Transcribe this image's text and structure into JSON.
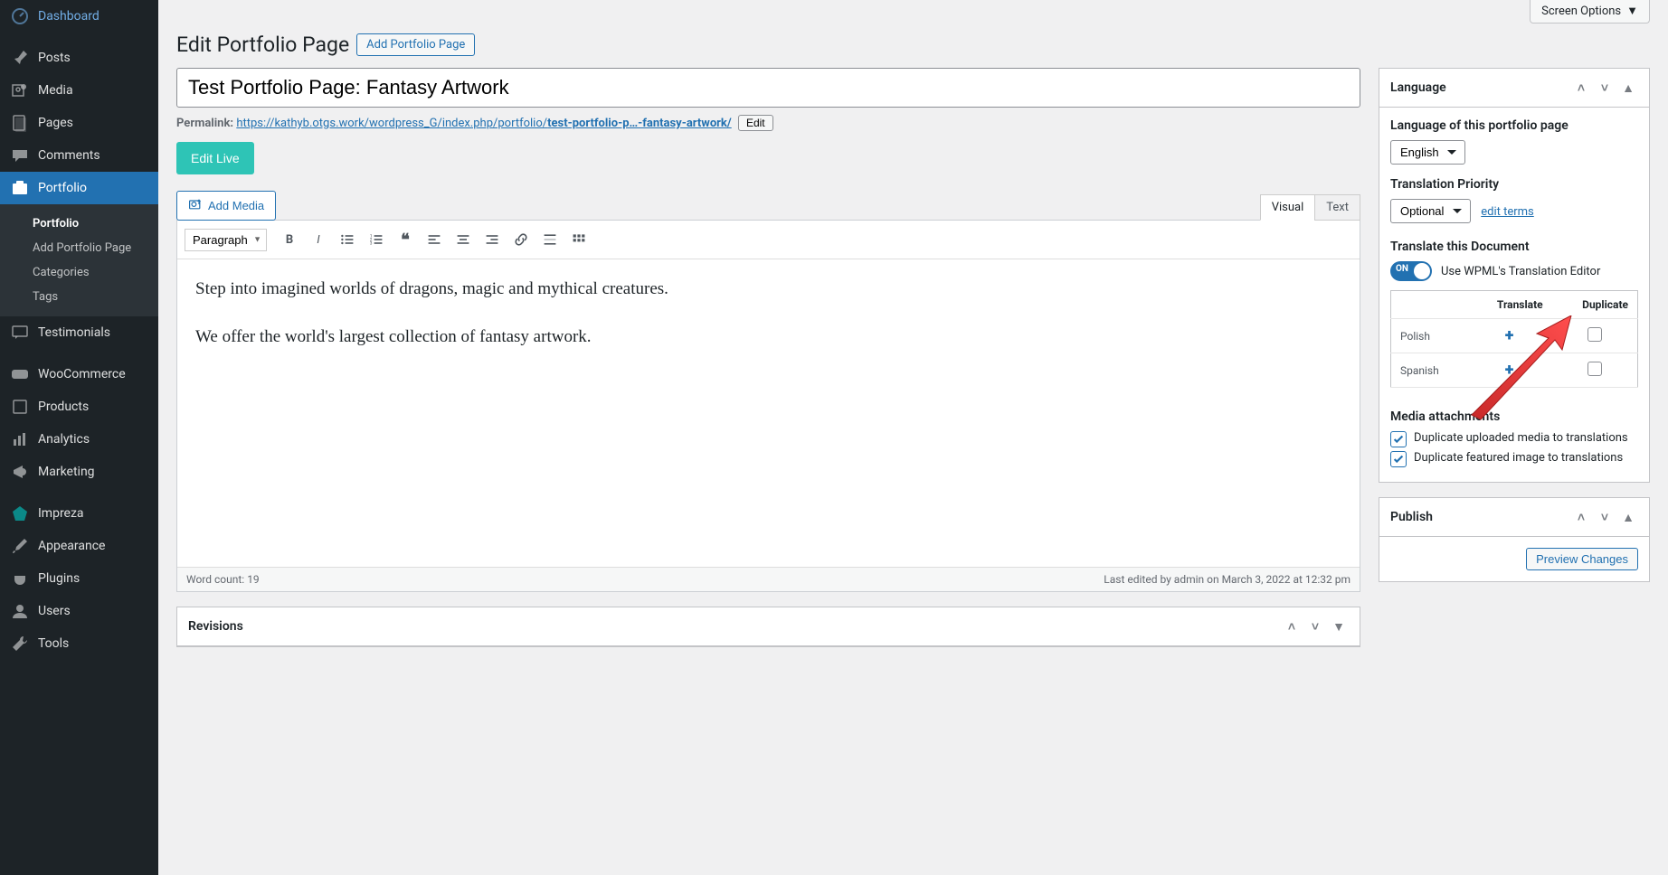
{
  "sidebar": {
    "dashboard": "Dashboard",
    "posts": "Posts",
    "media": "Media",
    "pages": "Pages",
    "comments": "Comments",
    "portfolio": "Portfolio",
    "portfolio_sub": {
      "portfolio": "Portfolio",
      "add": "Add Portfolio Page",
      "categories": "Categories",
      "tags": "Tags"
    },
    "testimonials": "Testimonials",
    "woocommerce": "WooCommerce",
    "products": "Products",
    "analytics": "Analytics",
    "marketing": "Marketing",
    "impreza": "Impreza",
    "appearance": "Appearance",
    "plugins": "Plugins",
    "users": "Users",
    "tools": "Tools"
  },
  "screen_options": "Screen Options",
  "heading": "Edit Portfolio Page",
  "add_new": "Add Portfolio Page",
  "title_value": "Test Portfolio Page: Fantasy Artwork",
  "permalink": {
    "label": "Permalink:",
    "base": "https://kathyb.otgs.work/wordpress_G/index.php/portfolio/",
    "slug": "test-portfolio-p…-fantasy-artwork/",
    "edit": "Edit"
  },
  "edit_live": "Edit Live",
  "add_media": "Add Media",
  "tabs": {
    "visual": "Visual",
    "text": "Text"
  },
  "paragraph_sel": "Paragraph",
  "content": {
    "p1": "Step into imagined worlds of dragons, magic and mythical creatures.",
    "p2": "We offer the world's largest collection of fantasy artwork."
  },
  "status": {
    "word_count_label": "Word count: ",
    "word_count": "19",
    "last_edited": "Last edited by admin on March 3, 2022 at 12:32 pm"
  },
  "revisions_title": "Revisions",
  "language_panel": {
    "title": "Language",
    "lang_label": "Language of this portfolio page",
    "lang_value": "English",
    "priority_label": "Translation Priority",
    "priority_value": "Optional",
    "edit_terms": "edit terms",
    "translate_doc": "Translate this Document",
    "toggle_label": "Use WPML's Translation Editor",
    "th_translate": "Translate",
    "th_duplicate": "Duplicate",
    "langs": {
      "pl": "Polish",
      "es": "Spanish"
    },
    "media_att": "Media attachments",
    "dup_media": "Duplicate uploaded media to translations",
    "dup_featured": "Duplicate featured image to translations"
  },
  "publish_title": "Publish",
  "preview_changes": "Preview Changes"
}
